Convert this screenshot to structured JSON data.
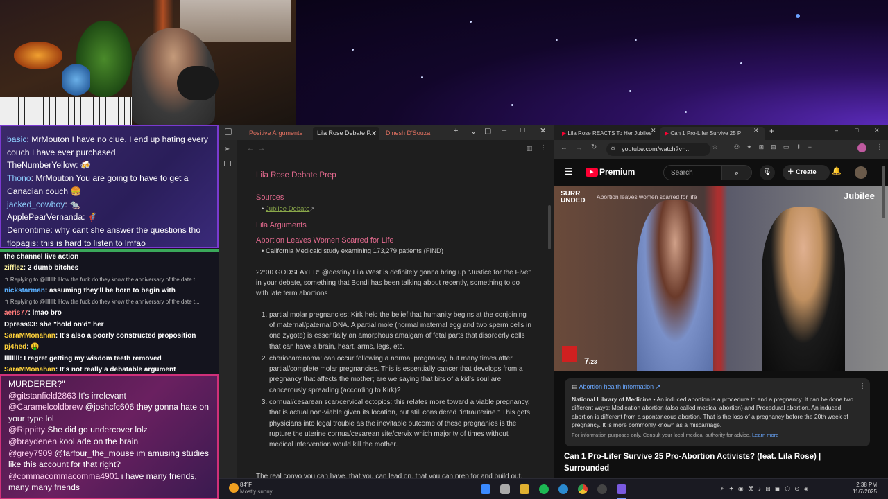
{
  "webcam": {
    "alt": "streamer webcam"
  },
  "chat_top": {
    "messages": [
      {
        "user": "basic",
        "user_color": "#8fd0ff",
        "text": ": MrMouton I have no clue. I end up hating every couch I have ever purchased"
      },
      {
        "user": "TheNumberYellow",
        "user_color": "#ffffff",
        "text": ": 🍻"
      },
      {
        "user": "Thono",
        "user_color": "#8fd0ff",
        "text": ": MrMouton You are going to have to get a Canadian couch 🍔"
      },
      {
        "user": "jacked_cowboy",
        "user_color": "#8fd0ff",
        "text": ": 🐀"
      },
      {
        "user": "ApplePearVernanda",
        "user_color": "#ffffff",
        "text": ": 🦸"
      },
      {
        "user": "Demontime",
        "user_color": "#ffffff",
        "text": ": why cant she answer the questions tho"
      },
      {
        "user": "flopagis",
        "user_color": "#ffffff",
        "text": ": this is hard to listen to lmfao"
      }
    ]
  },
  "chat_mid": {
    "lines": [
      {
        "user": "",
        "text": "the channel live action",
        "reply": false
      },
      {
        "user": "zifflez",
        "user_color": "#fff5a0",
        "text": ": 2 dumb bitches",
        "reply": false
      },
      {
        "user": "",
        "text": "↰ Replying to @llllllll: How the fuck do they know the anniversary of the date t...",
        "reply": true
      },
      {
        "user": "nickstarman",
        "user_color": "#5ab0ff",
        "text": ": assuming they'll be born to begin with",
        "reply": false
      },
      {
        "user": "",
        "text": "↰ Replying to @llllllll: How the fuck do they know the anniversary of the date t...",
        "reply": true
      },
      {
        "user": "aeris77",
        "user_color": "#ff7a7a",
        "text": ": lmao bro",
        "reply": false
      },
      {
        "user": "Dpress93",
        "user_color": "#ffffff",
        "text": ": she \"hold on'd\" her",
        "reply": false
      },
      {
        "user": "SaraMMonahan",
        "user_color": "#ffd23a",
        "text": ": It's also a poorly constructed proposition",
        "reply": false
      },
      {
        "user": "pj4hed",
        "user_color": "#ffd23a",
        "text": ": 🤑",
        "reply": false
      },
      {
        "user": "llllllll",
        "user_color": "#ffffff",
        "text": ": I regret getting my wisdom teeth removed",
        "reply": false
      },
      {
        "user": "SaraMMonahan",
        "user_color": "#ffd23a",
        "text": ": It's not really a debatable argument",
        "reply": false
      }
    ]
  },
  "chat_bottom": {
    "lines": [
      {
        "user": "",
        "text": "MURDERER?\""
      },
      {
        "user": "@gitstanfield2863",
        "text": " It's irrelevant"
      },
      {
        "user": "@Caramelcoldbrew",
        "text": " @joshcfc606 they gonna hate on your type lol"
      },
      {
        "user": "@Rippitty",
        "text": " She did go undercover lolz"
      },
      {
        "user": "@braydenen",
        "text": " kool ade on the brain"
      },
      {
        "user": "@grey7909",
        "text": " @farfour_the_mouse im amusing studies like this account for that right?"
      },
      {
        "user": "@commacommacomma4901",
        "text": " i have many friends, many many friends"
      }
    ]
  },
  "notes": {
    "tabs": [
      "Positive Arguments",
      "Lila Rose Debate P...",
      "Dinesh D'Souza"
    ],
    "doc_title": "Lila Rose Debate Prep",
    "sources_heading": "Sources",
    "source_link": "Jubilee Debate",
    "args_heading": "Lila Arguments",
    "arg1_heading": "Abortion Leaves Women Scarred for Life",
    "arg1_bullet": "California Medicaid study examining 173,279 patients (FIND)",
    "quote": "22:00 GODSLAYER: @destiny Lila West is definitely gonna bring up \"Justice for the Five\" in your debate, something that Bondi has been talking about recently, something to do with late term abortions",
    "items": [
      "partial molar pregnancies: Kirk held the belief that humanity begins at the conjoining of maternal/paternal DNA.  A partial mole (normal maternal egg and two sperm cells in one zygote) is essentially an amorphous amalgam of fetal parts that disorderly cells that can have a brain, heart, arms, legs, etc.",
      "choriocarcinoma: can occur following a normal pregnancy, but many times after partial/complete molar pregnancies.  This is essentially cancer that develops from a pregnancy that affects the mother; are we saying that bits of a kid's soul are cancerously spreading (according to Kirk)?",
      "cornual/cesarean scar/cervical ectopics: this relates more toward a viable pregnancy, that is actual non-viable given its location, but still considered \"intrauterine.\" This gets physicians into legal trouble as the inevitable outcome of these pregnanies is the rupture the uterine cornua/cesarean site/cervix which majority of times without medical intervention would kill the mother."
    ],
    "footer_text": "The real convo you can have, that you can lead on, that you can prep for and build out,"
  },
  "browser": {
    "tabs": [
      "Lila Rose REACTS To Her Jubilee",
      "Can 1 Pro-Lifer Survive 25 P"
    ],
    "url": "youtube.com/watch?v=...",
    "brand": "Premium",
    "search_placeholder": "Search",
    "create_label": "Create",
    "video_overlay_brand": "SURR UNDED",
    "video_overlay_caption": "Abortion leaves women scarred for life",
    "video_jubilee": "Jubilee",
    "video_counter": "7",
    "video_counter_total": "/23",
    "info_heading": "Abortion health information ↗",
    "info_source": "National Library of Medicine",
    "info_body": " • An induced abortion is a procedure to end a pregnancy. It can be done two different ways: Medication abortion (also called medical abortion) and Procedural abortion. An induced abortion is different from a spontaneous abortion. That is the loss of a pregnancy before the 20th week of pregnancy. It is more commonly known as a miscarriage.",
    "info_footer": "For information purposes only. Consult your local medical authority for advice.",
    "info_learn": "Learn more",
    "video_title": "Can 1 Pro-Lifer Survive 25 Pro-Abortion Activists? (feat. Lila Rose) | Surrounded"
  },
  "taskbar": {
    "weather_temp": "84°F",
    "weather_desc": "Mostly sunny",
    "time": "2:38 PM",
    "date": "11/7/2025"
  },
  "colors": {
    "accent_pink": "#e36a8e",
    "yt_red": "#ff0033",
    "chat_border_purple": "#7a3ad0",
    "chat_border_green": "#3aa85a",
    "chat_border_pink": "#d0307a"
  }
}
